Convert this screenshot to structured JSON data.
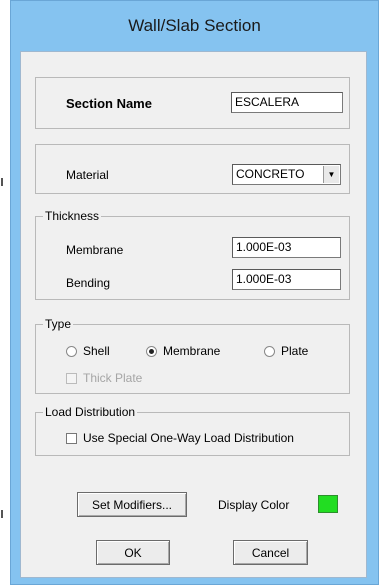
{
  "window": {
    "title": "Wall/Slab Section"
  },
  "section_name": {
    "label": "Section Name",
    "value": "ESCALERA"
  },
  "material": {
    "label": "Material",
    "selected": "CONCRETO"
  },
  "thickness": {
    "group_label": "Thickness",
    "membrane_label": "Membrane",
    "membrane_value": "1.000E-03",
    "bending_label": "Bending",
    "bending_value": "1.000E-03"
  },
  "type": {
    "group_label": "Type",
    "options": [
      "Shell",
      "Membrane",
      "Plate"
    ],
    "selected": "Membrane",
    "thick_plate_label": "Thick Plate",
    "thick_plate_checked": false,
    "thick_plate_enabled": false
  },
  "load_distribution": {
    "group_label": "Load Distribution",
    "checkbox_label": "Use Special One-Way Load Distribution",
    "checked": false
  },
  "modifiers_button": "Set Modifiers...",
  "display_color": {
    "label": "Display Color",
    "color": "#22dd22"
  },
  "buttons": {
    "ok": "OK",
    "cancel": "Cancel"
  },
  "colors": {
    "title_bar": "#85c3f0",
    "client_bg": "#f0f0f0"
  }
}
